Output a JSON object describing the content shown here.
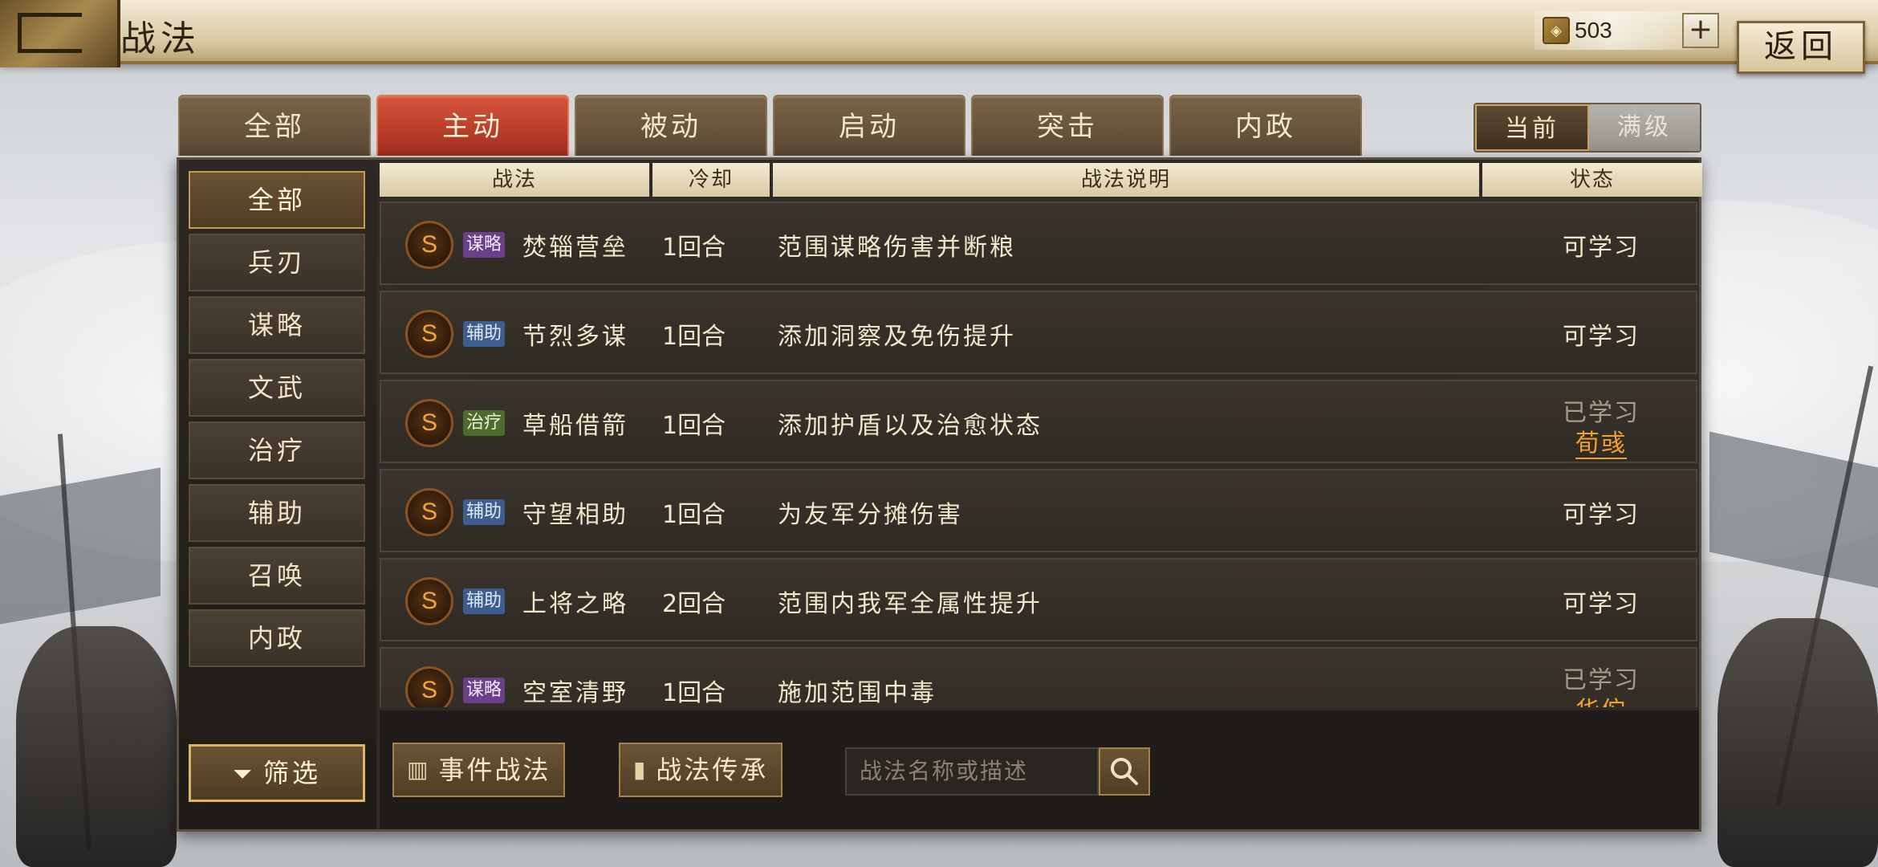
{
  "header": {
    "title": "战法",
    "currency_amount": "503",
    "plus_label": "+",
    "back_label": "返回"
  },
  "tabs": [
    {
      "label": "全部",
      "active": false
    },
    {
      "label": "主动",
      "active": true
    },
    {
      "label": "被动",
      "active": false
    },
    {
      "label": "启动",
      "active": false
    },
    {
      "label": "突击",
      "active": false
    },
    {
      "label": "内政",
      "active": false
    }
  ],
  "level_toggle": {
    "current": "当前",
    "max": "满级",
    "selected": "当前"
  },
  "sidebar": {
    "items": [
      "全部",
      "兵刃",
      "谋略",
      "文武",
      "治疗",
      "辅助",
      "召唤",
      "内政"
    ],
    "selected": "全部",
    "filter_label": "筛选"
  },
  "table": {
    "headers": [
      "战法",
      "冷却",
      "战法说明",
      "状态"
    ],
    "rows": [
      {
        "grade": "S",
        "type": "谋略",
        "type_color": "#6b3f8a",
        "name": "焚辎营垒",
        "cooldown": "1回合",
        "desc": "范围谋略伤害并断粮",
        "status": "可学习",
        "learner": ""
      },
      {
        "grade": "S",
        "type": "辅助",
        "type_color": "#3d5d8e",
        "name": "节烈多谋",
        "cooldown": "1回合",
        "desc": "添加洞察及免伤提升",
        "status": "可学习",
        "learner": ""
      },
      {
        "grade": "S",
        "type": "治疗",
        "type_color": "#4d6b2c",
        "name": "草船借箭",
        "cooldown": "1回合",
        "desc": "添加护盾以及治愈状态",
        "status": "已学习",
        "learner": "荀彧"
      },
      {
        "grade": "S",
        "type": "辅助",
        "type_color": "#3d5d8e",
        "name": "守望相助",
        "cooldown": "1回合",
        "desc": "为友军分摊伤害",
        "status": "可学习",
        "learner": ""
      },
      {
        "grade": "S",
        "type": "辅助",
        "type_color": "#3d5d8e",
        "name": "上将之略",
        "cooldown": "2回合",
        "desc": "范围内我军全属性提升",
        "status": "可学习",
        "learner": ""
      },
      {
        "grade": "S",
        "type": "谋略",
        "type_color": "#6b3f8a",
        "name": "空室清野",
        "cooldown": "1回合",
        "desc": "施加范围中毒",
        "status": "已学习",
        "learner": "华佗"
      }
    ]
  },
  "bottom": {
    "event_label": "事件战法",
    "inherit_label": "战法传承",
    "search_placeholder": "战法名称或描述"
  },
  "colors": {
    "active_tab": "#c2412b",
    "learned_name": "#f0a030",
    "accent_gold": "#e0b560"
  },
  "icons": [
    "coin-icon",
    "plus-icon",
    "filter-funnel-icon",
    "event-icon",
    "scroll-icon",
    "search-icon"
  ]
}
